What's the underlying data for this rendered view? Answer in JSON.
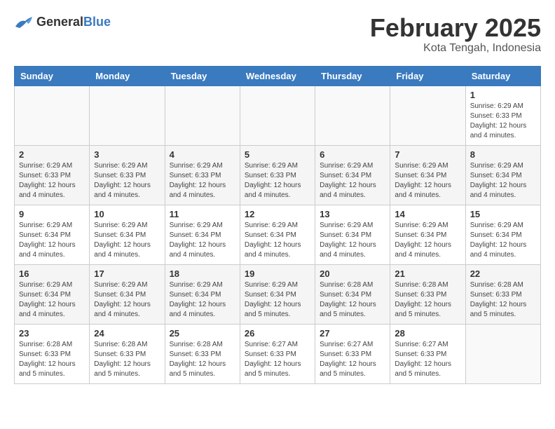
{
  "logo": {
    "general": "General",
    "blue": "Blue"
  },
  "header": {
    "month": "February 2025",
    "location": "Kota Tengah, Indonesia"
  },
  "weekdays": [
    "Sunday",
    "Monday",
    "Tuesday",
    "Wednesday",
    "Thursday",
    "Friday",
    "Saturday"
  ],
  "weeks": [
    [
      {
        "day": "",
        "info": ""
      },
      {
        "day": "",
        "info": ""
      },
      {
        "day": "",
        "info": ""
      },
      {
        "day": "",
        "info": ""
      },
      {
        "day": "",
        "info": ""
      },
      {
        "day": "",
        "info": ""
      },
      {
        "day": "1",
        "info": "Sunrise: 6:29 AM\nSunset: 6:33 PM\nDaylight: 12 hours and 4 minutes."
      }
    ],
    [
      {
        "day": "2",
        "info": "Sunrise: 6:29 AM\nSunset: 6:33 PM\nDaylight: 12 hours and 4 minutes."
      },
      {
        "day": "3",
        "info": "Sunrise: 6:29 AM\nSunset: 6:33 PM\nDaylight: 12 hours and 4 minutes."
      },
      {
        "day": "4",
        "info": "Sunrise: 6:29 AM\nSunset: 6:33 PM\nDaylight: 12 hours and 4 minutes."
      },
      {
        "day": "5",
        "info": "Sunrise: 6:29 AM\nSunset: 6:33 PM\nDaylight: 12 hours and 4 minutes."
      },
      {
        "day": "6",
        "info": "Sunrise: 6:29 AM\nSunset: 6:34 PM\nDaylight: 12 hours and 4 minutes."
      },
      {
        "day": "7",
        "info": "Sunrise: 6:29 AM\nSunset: 6:34 PM\nDaylight: 12 hours and 4 minutes."
      },
      {
        "day": "8",
        "info": "Sunrise: 6:29 AM\nSunset: 6:34 PM\nDaylight: 12 hours and 4 minutes."
      }
    ],
    [
      {
        "day": "9",
        "info": "Sunrise: 6:29 AM\nSunset: 6:34 PM\nDaylight: 12 hours and 4 minutes."
      },
      {
        "day": "10",
        "info": "Sunrise: 6:29 AM\nSunset: 6:34 PM\nDaylight: 12 hours and 4 minutes."
      },
      {
        "day": "11",
        "info": "Sunrise: 6:29 AM\nSunset: 6:34 PM\nDaylight: 12 hours and 4 minutes."
      },
      {
        "day": "12",
        "info": "Sunrise: 6:29 AM\nSunset: 6:34 PM\nDaylight: 12 hours and 4 minutes."
      },
      {
        "day": "13",
        "info": "Sunrise: 6:29 AM\nSunset: 6:34 PM\nDaylight: 12 hours and 4 minutes."
      },
      {
        "day": "14",
        "info": "Sunrise: 6:29 AM\nSunset: 6:34 PM\nDaylight: 12 hours and 4 minutes."
      },
      {
        "day": "15",
        "info": "Sunrise: 6:29 AM\nSunset: 6:34 PM\nDaylight: 12 hours and 4 minutes."
      }
    ],
    [
      {
        "day": "16",
        "info": "Sunrise: 6:29 AM\nSunset: 6:34 PM\nDaylight: 12 hours and 4 minutes."
      },
      {
        "day": "17",
        "info": "Sunrise: 6:29 AM\nSunset: 6:34 PM\nDaylight: 12 hours and 4 minutes."
      },
      {
        "day": "18",
        "info": "Sunrise: 6:29 AM\nSunset: 6:34 PM\nDaylight: 12 hours and 4 minutes."
      },
      {
        "day": "19",
        "info": "Sunrise: 6:29 AM\nSunset: 6:34 PM\nDaylight: 12 hours and 5 minutes."
      },
      {
        "day": "20",
        "info": "Sunrise: 6:28 AM\nSunset: 6:34 PM\nDaylight: 12 hours and 5 minutes."
      },
      {
        "day": "21",
        "info": "Sunrise: 6:28 AM\nSunset: 6:33 PM\nDaylight: 12 hours and 5 minutes."
      },
      {
        "day": "22",
        "info": "Sunrise: 6:28 AM\nSunset: 6:33 PM\nDaylight: 12 hours and 5 minutes."
      }
    ],
    [
      {
        "day": "23",
        "info": "Sunrise: 6:28 AM\nSunset: 6:33 PM\nDaylight: 12 hours and 5 minutes."
      },
      {
        "day": "24",
        "info": "Sunrise: 6:28 AM\nSunset: 6:33 PM\nDaylight: 12 hours and 5 minutes."
      },
      {
        "day": "25",
        "info": "Sunrise: 6:28 AM\nSunset: 6:33 PM\nDaylight: 12 hours and 5 minutes."
      },
      {
        "day": "26",
        "info": "Sunrise: 6:27 AM\nSunset: 6:33 PM\nDaylight: 12 hours and 5 minutes."
      },
      {
        "day": "27",
        "info": "Sunrise: 6:27 AM\nSunset: 6:33 PM\nDaylight: 12 hours and 5 minutes."
      },
      {
        "day": "28",
        "info": "Sunrise: 6:27 AM\nSunset: 6:33 PM\nDaylight: 12 hours and 5 minutes."
      },
      {
        "day": "",
        "info": ""
      }
    ]
  ]
}
